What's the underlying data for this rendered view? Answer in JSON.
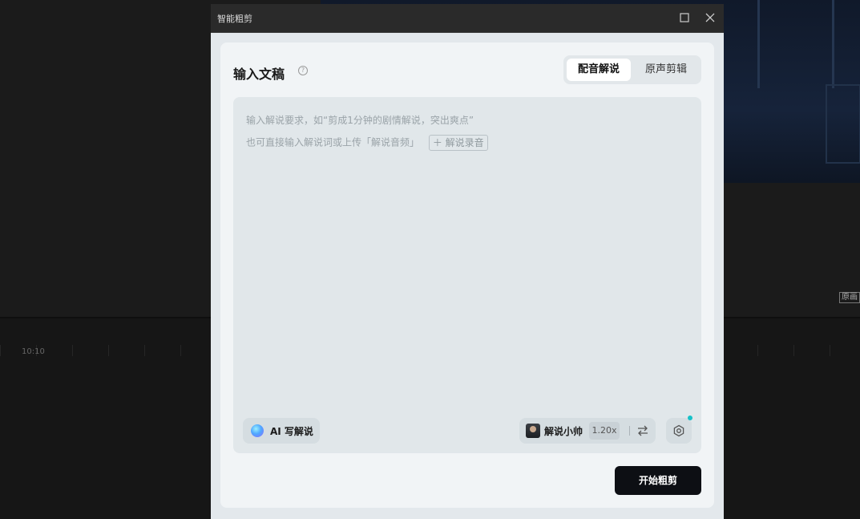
{
  "background": {
    "timecode": "10:10",
    "original_badge": "原画"
  },
  "dialog": {
    "title": "智能粗剪",
    "panel_title": "输入文稿",
    "help_icon": "?",
    "tabs": [
      {
        "label": "配音解说",
        "active": true
      },
      {
        "label": "原声剪辑",
        "active": false
      }
    ],
    "input": {
      "placeholder_line1": "输入解说要求，如“剪成1分钟的剧情解说，突出爽点”",
      "placeholder_line2": "也可直接输入解说词或上传「解说音频」",
      "upload_chip": "＋ 解说录音"
    },
    "ai_write_label": "AI 写解说",
    "voice": {
      "name": "解说小帅",
      "speed": "1.20x"
    },
    "start_label": "开始粗剪",
    "accent_color": "#16c1c8"
  }
}
